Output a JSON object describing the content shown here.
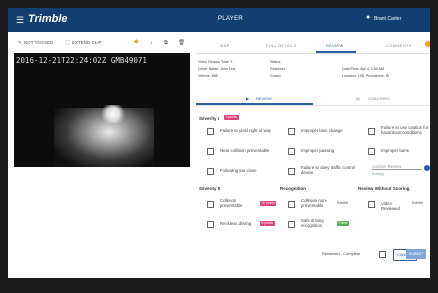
{
  "topbar": {
    "menu_icon": "hamburger-icon",
    "logo": "Trimble",
    "title": "PLAYER",
    "user_icon": "user-icon",
    "user_name": "Brant Carter"
  },
  "player": {
    "not_tagged": "NOT TAGGED",
    "extend_clip": "EXTEND CLIP",
    "timestamp": "2016-12-21T22:24:02Z GMB49071"
  },
  "tabs": {
    "items": [
      "MAP",
      "FULL DETAILS",
      "REVIEW",
      "COMMENTS"
    ],
    "active": "REVIEW",
    "comments_badge": ""
  },
  "info": {
    "video_review_total": "Video Review Total: 3",
    "driver_name": "Driver Name: John Doe",
    "vehicle": "Vehicle: 888",
    "status": "Status:",
    "reviewer": "Reviewer:",
    "coach": "Coach:",
    "datetime": "Date/Time: Apr 4, 2:00 AM",
    "location": "Location: I-95, Providence, RI"
  },
  "subtabs": {
    "review": "REVIEW",
    "coaching": "COACHING"
  },
  "severity1": {
    "heading": "Severity I",
    "badge": "2 points",
    "items": [
      "Failure to yield right of way",
      "Improper lane change",
      "Failure to use caution for hazardous conditions",
      "Near collision preventable",
      "Improper passing",
      "Improper turns",
      "Following too close",
      "Failure to obey traffic control device"
    ],
    "custom_placeholder": "Custom Review",
    "custom_hint": "Scoring"
  },
  "severity2": {
    "heading": "Severity II",
    "items": [
      "Collision preventable",
      "Reckless driving"
    ],
    "badges": [
      "10 points",
      "5 points"
    ]
  },
  "recognition": {
    "heading": "Recognition",
    "items": [
      "Collision non-preventable",
      "Safe driving recognition"
    ],
    "notes": [
      "Exhibit",
      ""
    ],
    "badges": [
      "",
      "Points"
    ]
  },
  "no_scoring": {
    "heading": "Review Without Scoring",
    "items": [
      "Video Reviewed",
      "Exhibit"
    ]
  },
  "footer": {
    "reviewed_complete": "Reviewed - Complete",
    "cancel": "CANCEL",
    "submit": "SUBMIT"
  },
  "colors": {
    "topbar": "#123e72",
    "accent": "#2a5fa8",
    "badge_pink": "#e0407a",
    "badge_green": "#4caf50",
    "badge_orange": "#f0a020"
  }
}
